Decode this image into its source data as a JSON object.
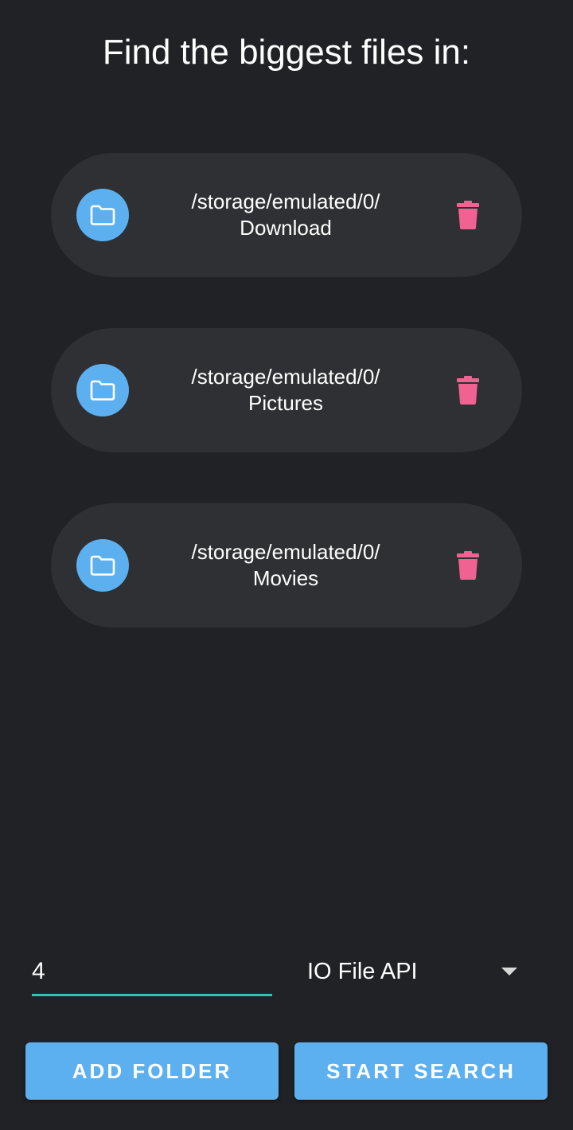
{
  "header": {
    "title": "Find the biggest files in:"
  },
  "folders": [
    {
      "line1": "/storage/emulated/0/",
      "line2": "Download"
    },
    {
      "line1": "/storage/emulated/0/",
      "line2": "Pictures"
    },
    {
      "line1": "/storage/emulated/0/",
      "line2": "Movies"
    }
  ],
  "controls": {
    "depth_value": "4",
    "api_selected": "IO File API"
  },
  "buttons": {
    "add_folder": "ADD FOLDER",
    "start_search": "START SEARCH"
  },
  "colors": {
    "background": "#212226",
    "card": "#2f3033",
    "accent_blue": "#5cb0f0",
    "delete_pink": "#f06292",
    "underline_teal": "#2ec4b6"
  },
  "icons": {
    "folder": "folder-icon",
    "delete": "trash-icon",
    "dropdown": "chevron-down-icon"
  }
}
